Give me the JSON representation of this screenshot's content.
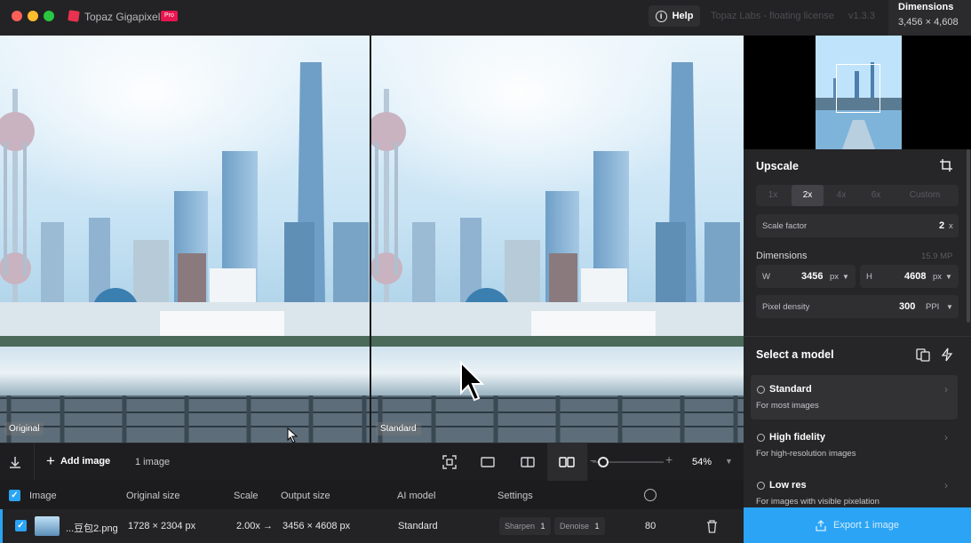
{
  "titlebar": {
    "app_name": "Topaz Gigapixel",
    "badge": "Pro",
    "help_label": "Help",
    "license_text": "Topaz Labs - floating license",
    "version": "v1.3.3",
    "dimensions_title": "Dimensions",
    "dimensions_value": "3,456 × 4,608"
  },
  "preview": {
    "left_label": "Original",
    "right_label": "Standard"
  },
  "toolbar": {
    "add_image_label": "Add image",
    "image_count": "1 image",
    "zoom_value": "54%",
    "zoom_level": 0.15
  },
  "table": {
    "headers": {
      "image": "Image",
      "original_size": "Original size",
      "scale": "Scale",
      "output_size": "Output size",
      "ai_model": "AI model",
      "settings": "Settings"
    },
    "row": {
      "filename": "...豆包2.png",
      "original_size": "1728 × 2304 px",
      "scale": "2.00x →",
      "output_size": "3456 × 4608 px",
      "model": "Standard",
      "sharpen_label": "Sharpen",
      "sharpen_value": "1",
      "denoise_label": "Denoise",
      "denoise_value": "1",
      "quality": "80"
    }
  },
  "sidebar": {
    "upscale_title": "Upscale",
    "scale_options": [
      "1x",
      "2x",
      "4x",
      "6x",
      "Custom"
    ],
    "scale_active": "2x",
    "scale_factor_label": "Scale factor",
    "scale_factor_value": "2",
    "scale_factor_unit": "x",
    "dimensions_label": "Dimensions",
    "megapixels": "15.9 MP",
    "width_label": "W",
    "width_value": "3456",
    "width_unit": "px",
    "height_label": "H",
    "height_value": "4608",
    "height_unit": "px",
    "pixel_density_label": "Pixel density",
    "pixel_density_value": "300",
    "pixel_density_unit": "PPI",
    "model_title": "Select a model",
    "models": [
      {
        "name": "Standard",
        "desc": "For most images"
      },
      {
        "name": "High fidelity",
        "desc": "For high-resolution images"
      },
      {
        "name": "Low res",
        "desc": "For images with visible pixelation"
      }
    ],
    "export_label": "Export 1 image"
  },
  "colors": {
    "accent": "#2ba4f5",
    "brand": "#e8164f",
    "background": "#1b1b1d"
  }
}
